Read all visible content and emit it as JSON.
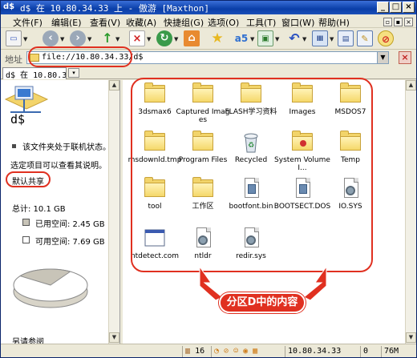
{
  "window": {
    "title": "d$ 在 10.80.34.33 上 - 傲游 [Maxthon]",
    "app_icon": "d$"
  },
  "menu": {
    "items": [
      "文件(F)",
      "编辑(E)",
      "查看(V)",
      "收藏(A)",
      "快捷组(G)",
      "选项(O)",
      "工具(T)",
      "窗口(W)",
      "帮助(H)"
    ]
  },
  "address": {
    "label": "地址",
    "value": "file://10.80.34.33/d$"
  },
  "tabs": [
    {
      "label": "d$ 在 10.80.3..."
    }
  ],
  "left_pane": {
    "drive_name": "d$",
    "online_status": "该文件夹处于联机状态。",
    "online_bold": "联机状态",
    "hint": "选定项目可以查看其说明。",
    "share": "默认共享",
    "total": "总计: 10.1 GB",
    "used": "已用空间: 2.45 GB",
    "free": "可用空间: 7.69 GB",
    "see_also": "另请参阅"
  },
  "files": [
    {
      "name": "3dsmax6",
      "type": "folder"
    },
    {
      "name": "Captured Images",
      "type": "folder"
    },
    {
      "name": "FLASH学习资料",
      "type": "folder"
    },
    {
      "name": "Images",
      "type": "folder"
    },
    {
      "name": "MSDOS7",
      "type": "folder"
    },
    {
      "name": "msdownld.tmp",
      "type": "folder"
    },
    {
      "name": "Program Files",
      "type": "folder"
    },
    {
      "name": "Recycled",
      "type": "recycle"
    },
    {
      "name": "System Volume I...",
      "type": "folder-system"
    },
    {
      "name": "Temp",
      "type": "folder"
    },
    {
      "name": "tool",
      "type": "folder"
    },
    {
      "name": "工作区",
      "type": "folder"
    },
    {
      "name": "bootfont.bin",
      "type": "file"
    },
    {
      "name": "BOOTSECT.DOS",
      "type": "file"
    },
    {
      "name": "IO.SYS",
      "type": "sys"
    },
    {
      "name": "ntdetect.com",
      "type": "app"
    },
    {
      "name": "ntldr",
      "type": "sys"
    },
    {
      "name": "redir.sys",
      "type": "sys"
    }
  ],
  "annotation": {
    "callout": "分区D中的内容",
    "color": "#e03020"
  },
  "status": {
    "count": "16",
    "ip": "10.80.34.33",
    "zero": "0",
    "mem": "76M"
  },
  "disk": {
    "used_fraction": 0.243
  }
}
